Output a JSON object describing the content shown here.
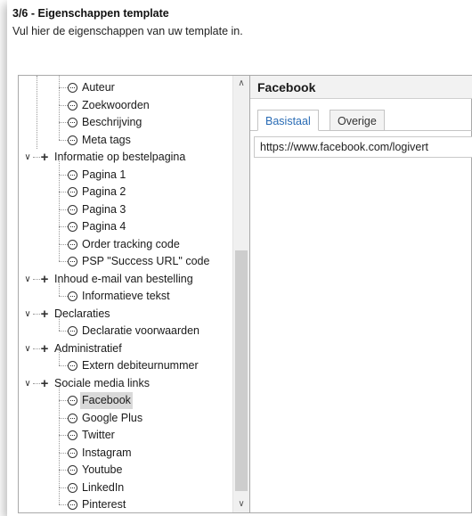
{
  "header": {
    "title": "3/6 - Eigenschappen template",
    "subtitle": "Vul hier de eigenschappen van uw template in."
  },
  "tree": {
    "items": [
      {
        "label": "Auteur",
        "type": "leaf"
      },
      {
        "label": "Zoekwoorden",
        "type": "leaf"
      },
      {
        "label": "Beschrijving",
        "type": "leaf"
      },
      {
        "label": "Meta tags",
        "type": "leaf"
      },
      {
        "label": "Informatie op bestelpagina",
        "type": "group"
      },
      {
        "label": "Pagina 1",
        "type": "leaf"
      },
      {
        "label": "Pagina 2",
        "type": "leaf"
      },
      {
        "label": "Pagina 3",
        "type": "leaf"
      },
      {
        "label": "Pagina 4",
        "type": "leaf"
      },
      {
        "label": "Order tracking code",
        "type": "leaf"
      },
      {
        "label": "PSP \"Success URL\" code",
        "type": "leaf"
      },
      {
        "label": "Inhoud e-mail van bestelling",
        "type": "group"
      },
      {
        "label": "Informatieve tekst",
        "type": "leaf"
      },
      {
        "label": "Declaraties",
        "type": "group"
      },
      {
        "label": "Declaratie voorwaarden",
        "type": "leaf"
      },
      {
        "label": "Administratief",
        "type": "group"
      },
      {
        "label": "Extern debiteurnummer",
        "type": "leaf"
      },
      {
        "label": "Sociale media links",
        "type": "group"
      },
      {
        "label": "Facebook",
        "type": "leaf",
        "selected": true
      },
      {
        "label": "Google Plus",
        "type": "leaf"
      },
      {
        "label": "Twitter",
        "type": "leaf"
      },
      {
        "label": "Instagram",
        "type": "leaf"
      },
      {
        "label": "Youtube",
        "type": "leaf"
      },
      {
        "label": "LinkedIn",
        "type": "leaf"
      },
      {
        "label": "Pinterest",
        "type": "leaf"
      }
    ]
  },
  "detail": {
    "title": "Facebook",
    "tabs": [
      "Basistaal",
      "Overige talen"
    ],
    "active_tab": "Basistaal",
    "url_value": "https://www.facebook.com/logivert"
  },
  "icons": {
    "scroll_up": "chevron-up-icon",
    "scroll_down": "chevron-down-icon",
    "expand": "chevron-down-icon",
    "group": "plus-icon",
    "leaf": "text-field-icon"
  },
  "colors": {
    "active_tab_text": "#2a6cb5",
    "selection": "#d9d9d9"
  }
}
